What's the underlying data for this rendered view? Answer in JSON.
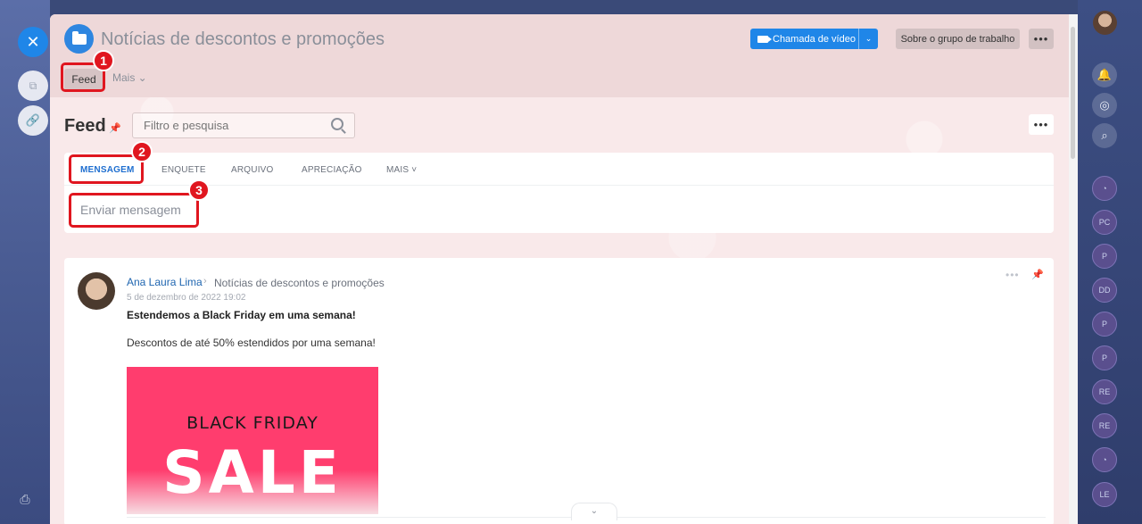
{
  "group": {
    "title": "Notícias de descontos e promoções",
    "video_call_label": "Chamada de vídeo",
    "video_call_dropdown": "⌄",
    "about_label": "Sobre o grupo de trabalho",
    "more_label": "•••"
  },
  "nav": {
    "feed_label": "Feed",
    "more_label": "Mais ⌄"
  },
  "feed": {
    "title": "Feed",
    "search_placeholder": "Filtro e pesquisa",
    "more_label": "•••"
  },
  "composer": {
    "tabs": [
      "MENSAGEM",
      "ENQUETE",
      "ARQUIVO",
      "APRECIAÇÃO",
      "MAIS ˅"
    ],
    "active_tab": "MENSAGEM",
    "message_placeholder": "Enviar mensagem"
  },
  "post": {
    "author": "Ana Laura Lima",
    "destination": "Notícias de descontos e promoções",
    "date": "5 de dezembro de 2022 19:02",
    "headline": "Estendemos a Black Friday em uma semana!",
    "body": "Descontos de até 50% estendidos por uma semana!",
    "image_line1": "BLACK FRIDAY",
    "image_line2": "SALE"
  },
  "rail": [
    "PC",
    "P",
    "DD",
    "P",
    "P",
    "RE",
    "RE",
    "LE"
  ],
  "annotations": [
    "1",
    "2",
    "3"
  ],
  "colors": {
    "accent": "#1f86e8",
    "annotation": "#e0161f",
    "sale_background": "#ff3d6e"
  }
}
